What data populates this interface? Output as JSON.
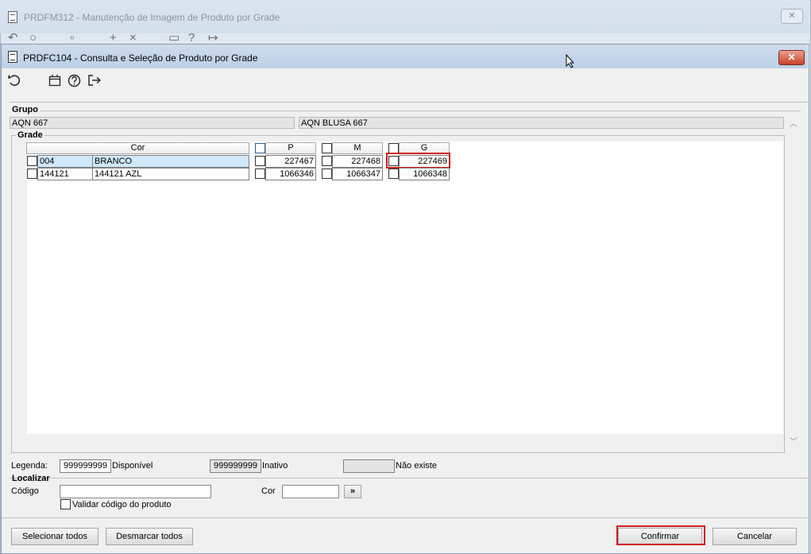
{
  "background_window": {
    "title": "PRDFM312 - Manutenção de Imagem de Produto por Grade",
    "close_label": "✕",
    "toolbar_icons": [
      "undo-icon",
      "search-icon",
      "save-icon",
      "add-icon",
      "delete-icon",
      "calendar-icon",
      "help-icon",
      "exit-icon"
    ]
  },
  "dialog": {
    "title": "PRDFC104 - Consulta e Seleção de Produto por Grade",
    "close_label": "✕",
    "toolbar_icons": [
      "undo-icon",
      "calendar-icon",
      "help-icon",
      "exit-icon"
    ]
  },
  "grupo": {
    "label": "Grupo",
    "code": "AQN 667",
    "description": "AQN BLUSA 667"
  },
  "grade": {
    "label": "Grade",
    "columns": {
      "cor": "Cor",
      "sizes": [
        "P",
        "M",
        "G"
      ]
    },
    "rows": [
      {
        "code": "004",
        "name": "BRANCO",
        "values": [
          "227467",
          "227468",
          "227469"
        ],
        "selected": true
      },
      {
        "code": "144121",
        "name": "144121 AZL",
        "values": [
          "1066346",
          "1066347",
          "1066348"
        ],
        "selected": false
      }
    ]
  },
  "legenda": {
    "label": "Legenda:",
    "items": [
      {
        "sample": "999999999",
        "text": "Disponível"
      },
      {
        "sample": "999999999",
        "text": "Inativo"
      },
      {
        "sample": "",
        "text": "Não existe"
      }
    ]
  },
  "localizar": {
    "label": "Localizar",
    "codigo_label": "Código",
    "codigo_value": "",
    "cor_label": "Cor",
    "cor_value": "",
    "go_label": "»",
    "validar_label": "Validar código do produto",
    "validar_checked": false
  },
  "buttons": {
    "selecionar": "Selecionar todos",
    "desmarcar": "Desmarcar todos",
    "confirmar": "Confirmar",
    "cancelar": "Cancelar"
  },
  "colors": {
    "selected_row": "#cfe8fa",
    "highlight": "#d11b1b",
    "inactive": "#e4e4e4"
  }
}
